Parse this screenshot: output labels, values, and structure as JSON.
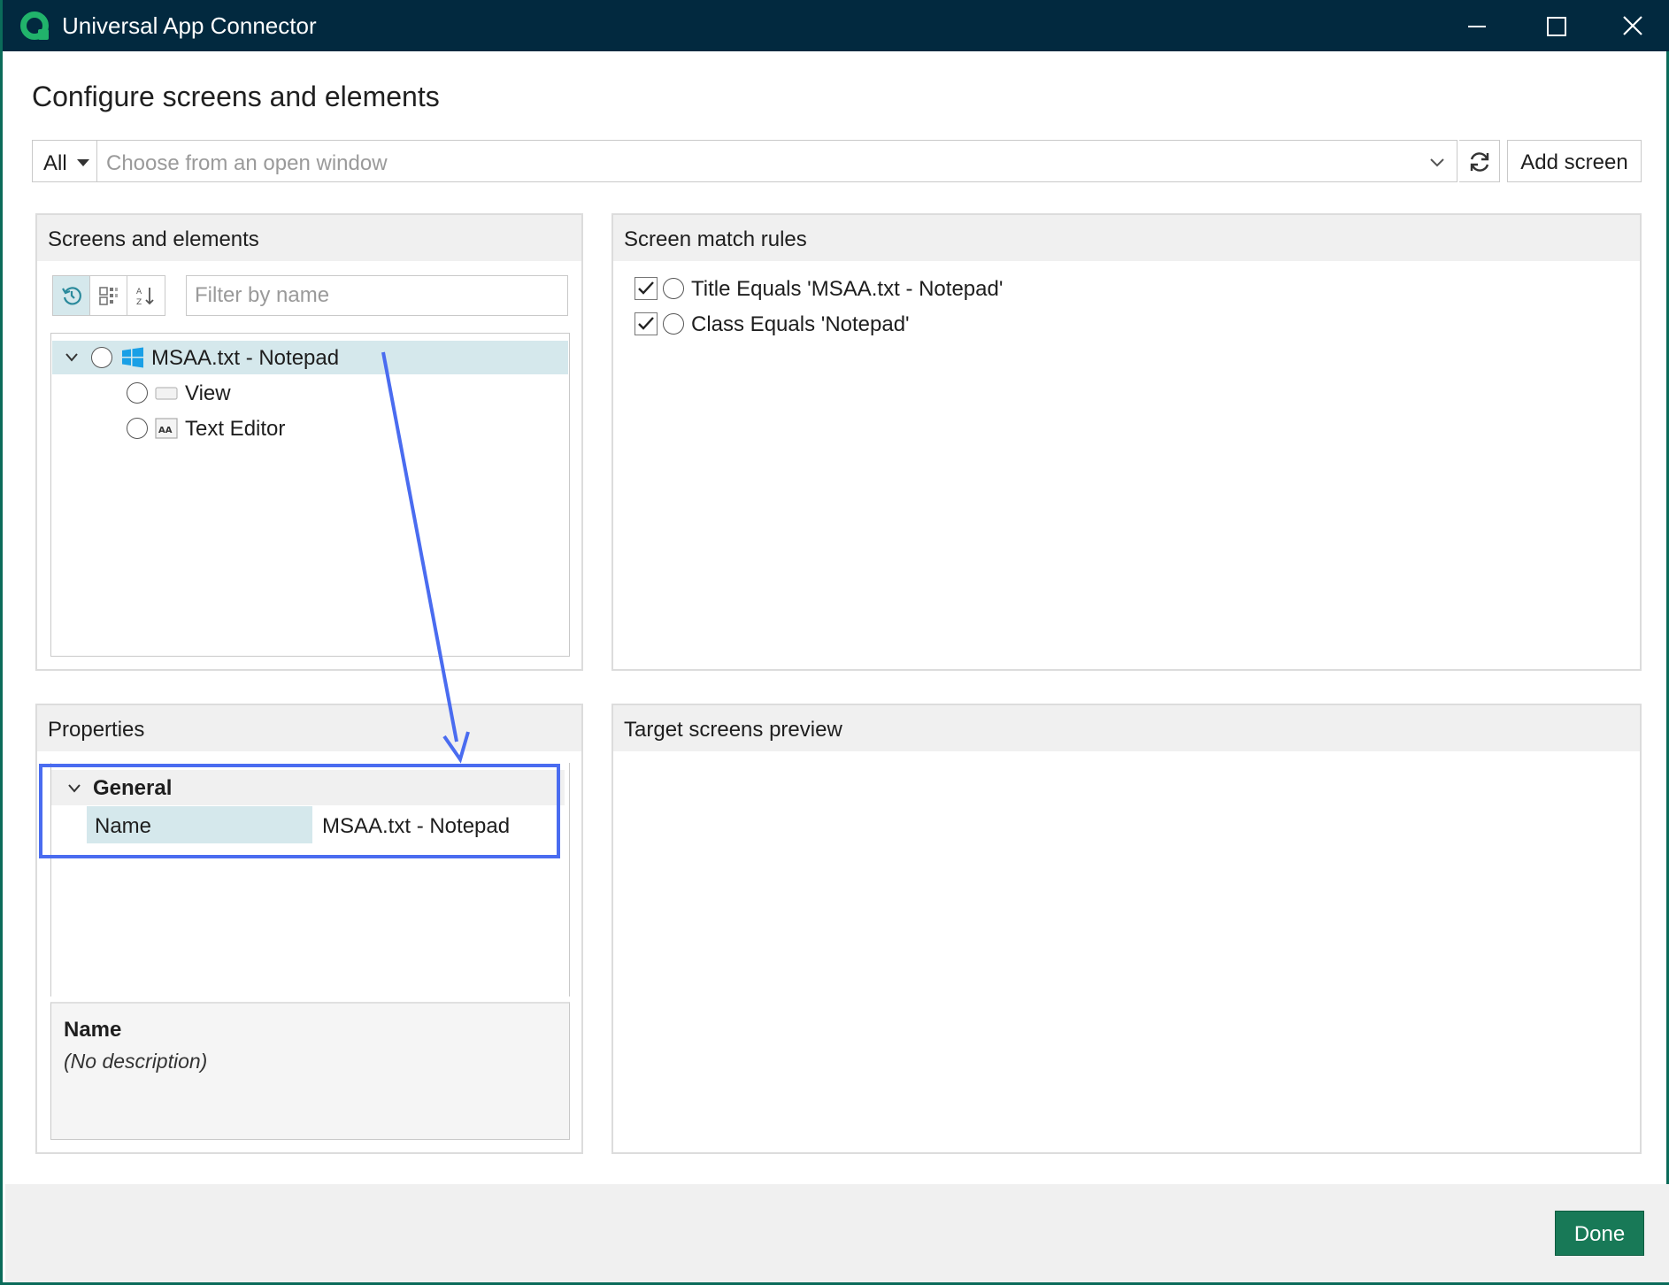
{
  "window": {
    "title": "Universal App Connector",
    "controls": [
      "minimize",
      "maximize",
      "close"
    ]
  },
  "page": {
    "heading": "Configure screens and elements"
  },
  "topbar": {
    "scope_value": "All",
    "window_picker_placeholder": "Choose from an open window",
    "add_screen_label": "Add screen"
  },
  "screens_panel": {
    "title": "Screens and elements",
    "filter_placeholder": "Filter by name",
    "tree": [
      {
        "label": "MSAA.txt - Notepad",
        "icon": "windows-icon",
        "level": 0,
        "expanded": true,
        "selected": true
      },
      {
        "label": "View",
        "icon": "view-icon",
        "level": 1
      },
      {
        "label": "Text Editor",
        "icon": "text-editor-icon",
        "level": 1
      }
    ]
  },
  "rules_panel": {
    "title": "Screen match rules",
    "rules": [
      {
        "label": "Title Equals 'MSAA.txt - Notepad'",
        "checked": true
      },
      {
        "label": "Class Equals 'Notepad'",
        "checked": true
      }
    ]
  },
  "properties_panel": {
    "title": "Properties",
    "category": "General",
    "property_name": "Name",
    "property_value": "MSAA.txt - Notepad",
    "description_title": "Name",
    "description_text": "(No description)"
  },
  "preview_panel": {
    "title": "Target screens preview"
  },
  "footer": {
    "done_label": "Done"
  },
  "colors": {
    "titlebar": "#02293f",
    "accent_green": "#187957",
    "selection": "#d5e8ec",
    "annotation_blue": "#4a6cf0"
  }
}
